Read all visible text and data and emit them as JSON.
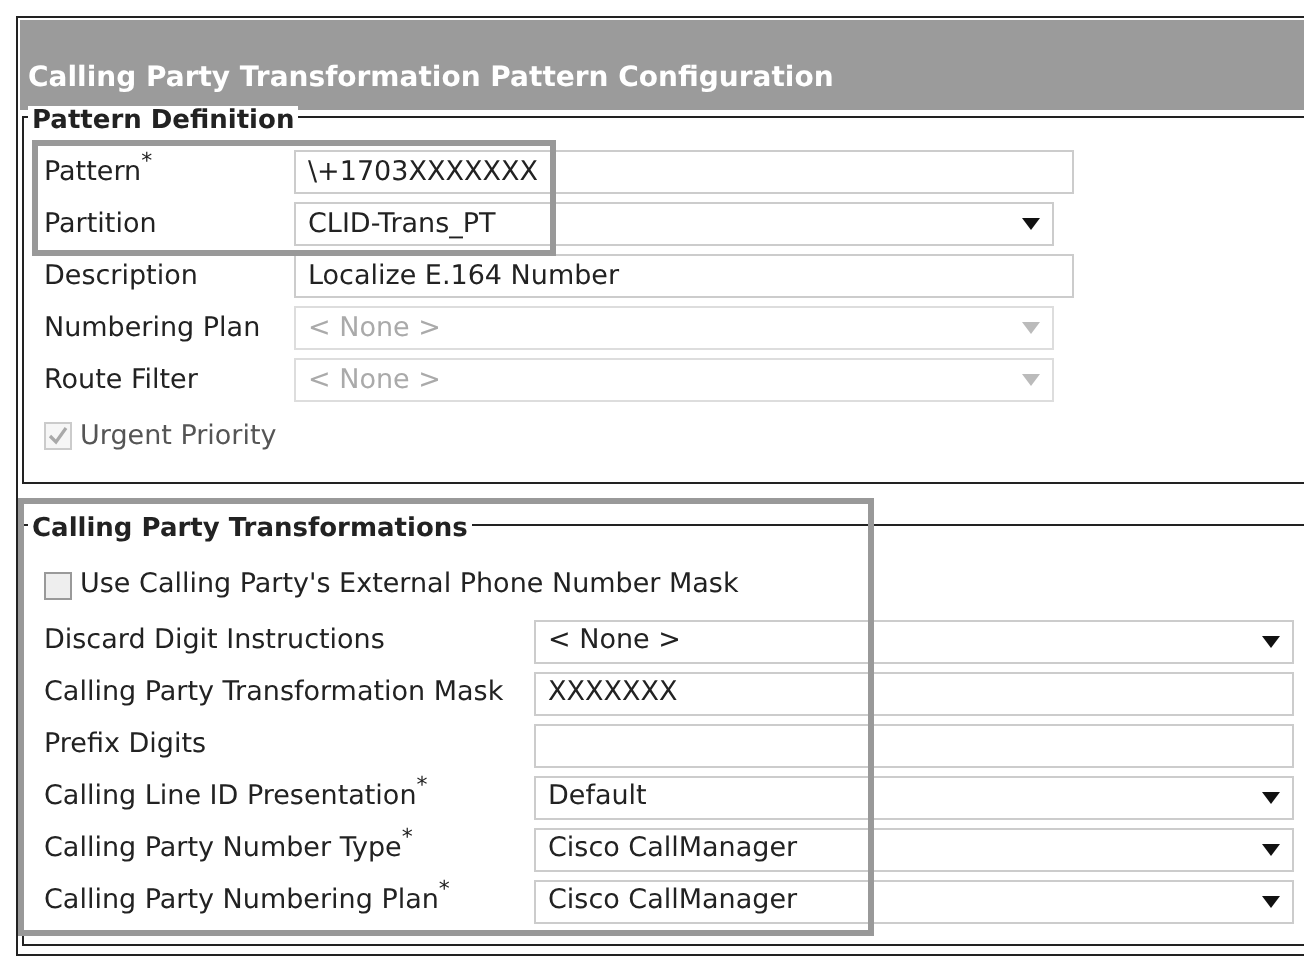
{
  "window": {
    "title": "Calling Party Transformation Pattern Configuration"
  },
  "sections": [
    {
      "legend": "Pattern Definition",
      "fields": [
        {
          "kind": "text",
          "label": "Pattern",
          "required_mark": "*",
          "value": "\\+1703XXXXXXX",
          "disabled": false,
          "highlighted": true
        },
        {
          "kind": "select",
          "label": "Partition",
          "value": "CLID-Trans_PT",
          "disabled": false,
          "highlighted": true
        },
        {
          "kind": "text",
          "label": "Description",
          "value": "Localize E.164 Number",
          "disabled": false
        },
        {
          "kind": "select",
          "label": "Numbering Plan",
          "value": "< None >",
          "disabled": true
        },
        {
          "kind": "select",
          "label": "Route Filter",
          "value": "< None >",
          "disabled": true
        },
        {
          "kind": "checkbox",
          "label": "Urgent Priority",
          "checked": true,
          "disabled": true
        }
      ]
    },
    {
      "legend": "Calling Party Transformations",
      "highlighted": true,
      "fields": [
        {
          "kind": "checkbox",
          "label": "Use Calling Party's External Phone Number Mask",
          "checked": false,
          "disabled": false
        },
        {
          "kind": "select",
          "label": "Discard Digit Instructions",
          "value": "< None >",
          "disabled": false
        },
        {
          "kind": "text",
          "label": "Calling Party Transformation Mask",
          "value": "XXXXXXX",
          "disabled": false
        },
        {
          "kind": "text",
          "label": "Prefix Digits",
          "disabled": false
        },
        {
          "kind": "select",
          "label": "Calling Line ID Presentation",
          "required_mark": "*",
          "value": "Default",
          "disabled": false
        },
        {
          "kind": "select",
          "label": "Calling Party Number Type",
          "required_mark": "*",
          "value": "Cisco CallManager",
          "disabled": false
        },
        {
          "kind": "select",
          "label": "Calling Party Numbering Plan",
          "required_mark": "*",
          "value": "Cisco CallManager",
          "disabled": false
        }
      ]
    }
  ]
}
